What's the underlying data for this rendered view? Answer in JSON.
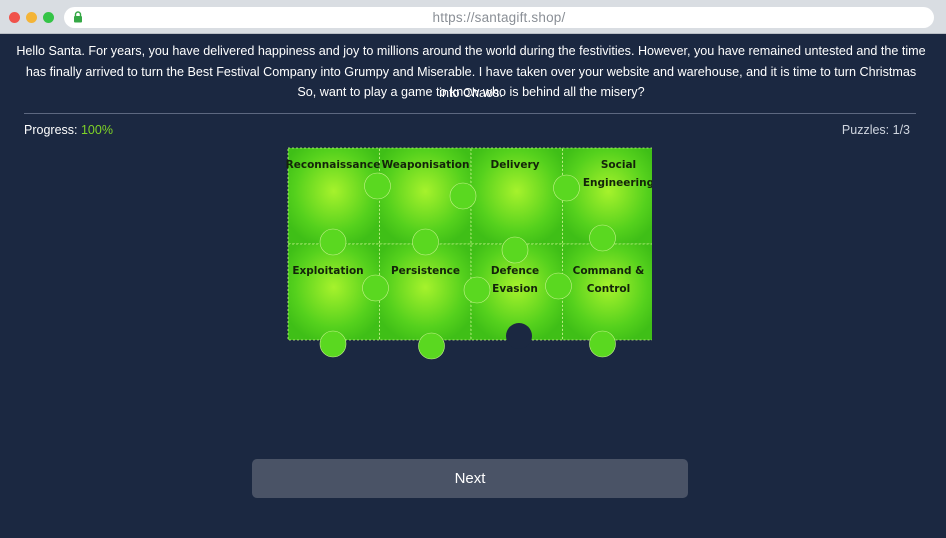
{
  "browser": {
    "url": "https://santagift.shop/"
  },
  "intro": {
    "message": "Hello Santa. For years, you have delivered happiness and joy to millions around the world during the festivities. However, you have remained untested and the time has finally arrived to turn the Best Festival Company into Grumpy and Miserable. I have taken over your website and warehouse, and it is time to turn Christmas into Chaos.",
    "question": "So, want to play a game to know who is behind all the misery?"
  },
  "progress": {
    "label": "Progress:",
    "value": "100%",
    "fraction": 1.0
  },
  "puzzles": {
    "label": "Puzzles: 1/3"
  },
  "puzzle_pieces": [
    {
      "lines": [
        "Reconnaissance"
      ]
    },
    {
      "lines": [
        "Weaponisation"
      ]
    },
    {
      "lines": [
        "Delivery"
      ]
    },
    {
      "lines": [
        "Social",
        "Engineering"
      ]
    },
    {
      "lines": [
        "Exploitation"
      ]
    },
    {
      "lines": [
        "Persistence"
      ]
    },
    {
      "lines": [
        "Defence",
        "Evasion"
      ]
    },
    {
      "lines": [
        "Command &",
        "Control"
      ]
    }
  ],
  "next_button": {
    "label": "Next"
  },
  "colors": {
    "background": "#1b2841",
    "accent_green": "#7fd327",
    "piece_green": "#52d11c",
    "button": "#4a5366"
  }
}
